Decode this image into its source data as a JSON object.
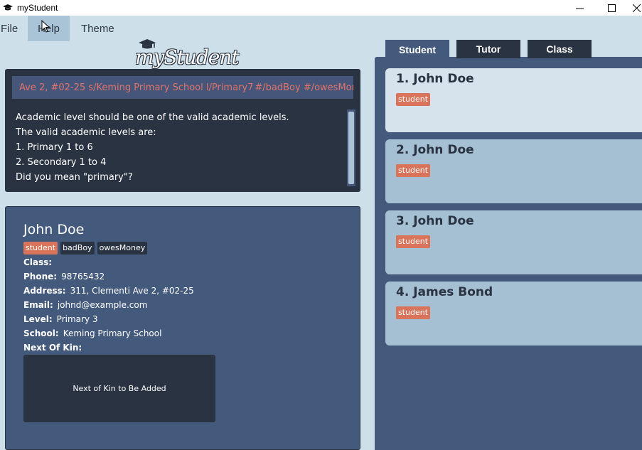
{
  "window": {
    "title": "myStudent",
    "controls": [
      "minimize-icon",
      "maximize-icon",
      "close-icon"
    ]
  },
  "menu": {
    "file": "File",
    "help": "Help",
    "theme": "Theme"
  },
  "logo": {
    "text": "myStudent"
  },
  "command": {
    "input_value": "Ave 2, #02-25 s/Keming Primary School l/Primary7",
    "input_tail": " #/badBoy #/owesMone"
  },
  "result": {
    "lines": [
      "Academic level should be one of the valid academic levels.",
      "The valid academic levels are:",
      "1. Primary 1 to 6",
      "2. Secondary 1 to 4",
      "Did you mean \"primary\"?"
    ]
  },
  "detail": {
    "name": "John Doe",
    "tags": [
      "student",
      "badBoy",
      "owesMoney"
    ],
    "fields": {
      "class_label": "Class:",
      "class_value": "",
      "phone_label": "Phone:",
      "phone_value": "98765432",
      "address_label": "Address:",
      "address_value": "311, Clementi Ave 2, #02-25",
      "email_label": "Email:",
      "email_value": "johnd@example.com",
      "level_label": "Level:",
      "level_value": "Primary 3",
      "school_label": "School:",
      "school_value": "Keming Primary School",
      "kin_label": "Next Of Kin:"
    },
    "kin_placeholder": "Next of Kin to Be Added"
  },
  "tabs": [
    "Student",
    "Tutor",
    "Class"
  ],
  "active_tab": "Student",
  "list": [
    {
      "name": "1. John Doe",
      "tag": "student"
    },
    {
      "name": "2. John Doe",
      "tag": "student"
    },
    {
      "name": "3. John Doe",
      "tag": "student"
    },
    {
      "name": "4. James Bond",
      "tag": "student"
    }
  ],
  "colors": {
    "background": "#cddfe9",
    "dark_panel": "#2a3342",
    "mid_panel": "#445a7c",
    "tag_student": "#d9735a",
    "error_text": "#e0736a",
    "card": "#a5bfd3",
    "card_selected": "#d7e3ec"
  }
}
